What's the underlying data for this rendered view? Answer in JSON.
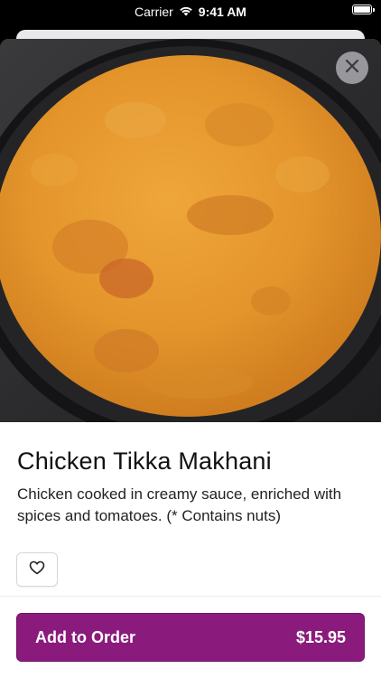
{
  "status_bar": {
    "carrier": "Carrier",
    "time": "9:41 AM"
  },
  "item": {
    "name": "Chicken Tikka Makhani",
    "description": "Chicken cooked in creamy sauce, enriched with spices and tomatoes. (* Contains nuts)",
    "price": "$15.95",
    "photo_icon": "dish-photo"
  },
  "actions": {
    "add_to_order_label": "Add to Order",
    "close_icon": "close-icon",
    "favorite_icon": "heart-icon"
  },
  "colors": {
    "primary_button": "#8a1b7c",
    "sauce": "#e59a2c"
  }
}
